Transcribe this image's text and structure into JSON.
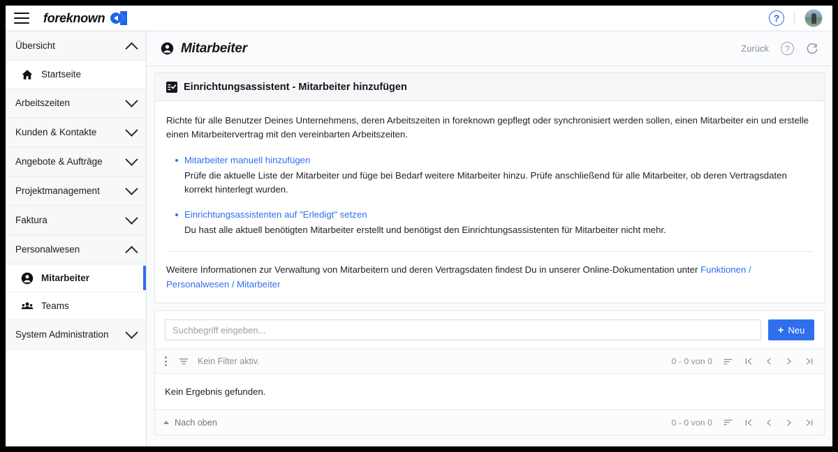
{
  "topbar": {
    "menu_icon": "hamburger-menu-icon",
    "brand_name": "foreknown",
    "brand_mark_icon": "foreknown-logo-icon",
    "help_label": "?",
    "avatar_icon": "user-avatar"
  },
  "sidebar": {
    "items": [
      {
        "label": "Übersicht",
        "type": "group",
        "expanded": true,
        "icon": "chevron-up-icon"
      },
      {
        "label": "Startseite",
        "type": "item",
        "icon": "home-icon",
        "active": false
      },
      {
        "label": "Arbeitszeiten",
        "type": "group",
        "expanded": false,
        "icon": "chevron-down-icon"
      },
      {
        "label": "Kunden & Kontakte",
        "type": "group",
        "expanded": false,
        "icon": "chevron-down-icon"
      },
      {
        "label": "Angebote & Aufträge",
        "type": "group",
        "expanded": false,
        "icon": "chevron-down-icon"
      },
      {
        "label": "Projektmanagement",
        "type": "group",
        "expanded": false,
        "icon": "chevron-down-icon"
      },
      {
        "label": "Faktura",
        "type": "group",
        "expanded": false,
        "icon": "chevron-down-icon"
      },
      {
        "label": "Personalwesen",
        "type": "group",
        "expanded": true,
        "icon": "chevron-up-icon"
      },
      {
        "label": "Mitarbeiter",
        "type": "item",
        "icon": "person-icon",
        "active": true
      },
      {
        "label": "Teams",
        "type": "item",
        "icon": "people-group-icon",
        "active": false
      },
      {
        "label": "System Administration",
        "type": "group",
        "expanded": false,
        "icon": "chevron-down-icon"
      }
    ]
  },
  "page_header": {
    "icon": "person-icon",
    "title": "Mitarbeiter",
    "back_label": "Zurück",
    "help_label": "?",
    "refresh_icon": "refresh-icon"
  },
  "wizard_card": {
    "icon": "checklist-icon",
    "title": "Einrichtungsassistent - Mitarbeiter hinzufügen",
    "intro": "Richte für alle Benutzer Deines Unternehmens, deren Arbeitszeiten in foreknown gepflegt oder synchronisiert werden sollen, einen Mitarbeiter ein und erstelle einen Mitarbeitervertrag mit den vereinbarten Arbeitszeiten.",
    "tasks": [
      {
        "link": "Mitarbeiter manuell hinzufügen",
        "description": "Prüfe die aktuelle Liste der Mitarbeiter und füge bei Bedarf weitere Mitarbeiter hinzu. Prüfe anschließend für alle Mitarbeiter, ob deren Vertragsdaten korrekt hinterlegt wurden."
      },
      {
        "link": "Einrichtungsassistenten auf \"Erledigt\" setzen",
        "description": "Du hast alle aktuell benötigten Mitarbeiter erstellt und benötigst den Einrichtungsassistenten für Mitarbeiter nicht mehr."
      }
    ],
    "footnote_prefix": "Weitere Informationen zur Verwaltung von Mitarbeitern und deren Vertragsdaten findest Du in unserer Online-Dokumentation unter ",
    "footnote_link_1": "Funktionen",
    "footnote_sep_1": " / ",
    "footnote_link_2": "Personalwesen",
    "footnote_sep_2": " / ",
    "footnote_link_3": "Mitarbeiter"
  },
  "list_card": {
    "search_placeholder": "Suchbegriff eingeben...",
    "search_value": "",
    "new_button_label": "Neu",
    "new_button_icon": "plus-icon",
    "menu_icon": "more-vertical-icon",
    "filter_icon": "filter-icon",
    "filter_text": "Kein Filter aktiv.",
    "pagination": {
      "count": "0 - 0 von 0",
      "sort_icon": "sort-icon",
      "first_icon": "first-page-icon",
      "prev_icon": "previous-page-icon",
      "next_icon": "next-page-icon",
      "last_icon": "last-page-icon"
    },
    "empty_message": "Kein Ergebnis gefunden.",
    "back_to_top_label": "Nach oben",
    "back_to_top_icon": "caret-up-icon"
  },
  "colors": {
    "accent": "#2f6fed",
    "link": "#2f6fed",
    "muted": "#8a9099",
    "text": "#1e2024",
    "panel_bg": "#fafbfc",
    "header_bg": "#f6f7f8"
  }
}
